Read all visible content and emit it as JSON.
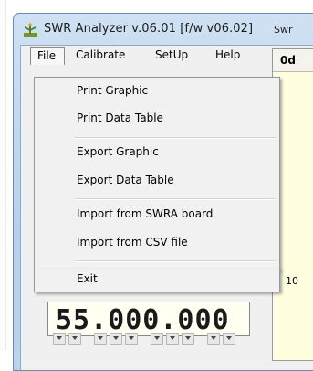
{
  "window": {
    "title": "SWR Analyzer v.06.01 [f/w v06.02]"
  },
  "menubar": {
    "file": "File",
    "calibrate": "Calibrate",
    "setup": "SetUp",
    "help": "Help"
  },
  "file_menu": {
    "items": [
      "Print Graphic",
      "Print Data Table",
      "Export Graphic",
      "Export Data Table",
      "Import from SWRA board",
      "Import from CSV file",
      "Exit"
    ]
  },
  "swr_panel": {
    "tab_label": "Swr",
    "header_value": "0d",
    "axis_tick": "10"
  },
  "frequency_display": {
    "digits": "55.000.000"
  },
  "colors": {
    "title_bar": "#b8d1ea",
    "graph_background": "#ffffe0",
    "menu_background": "#f1f1f1"
  },
  "icons": {
    "app": "antenna-icon"
  }
}
